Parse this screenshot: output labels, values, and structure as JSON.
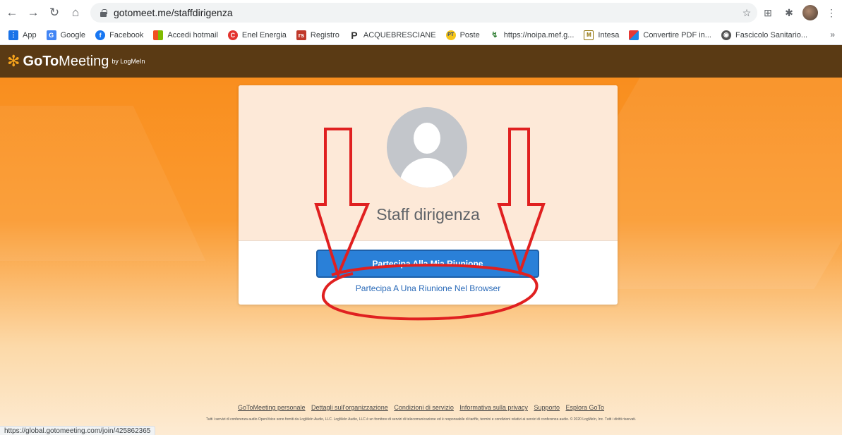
{
  "browser": {
    "url": "gotomeet.me/staffdirigenza",
    "status_url": "https://global.gotomeeting.com/join/425862365"
  },
  "bookmarks": [
    {
      "label": "App",
      "icon": "apps-grid-icon",
      "color": "#1a73e8"
    },
    {
      "label": "Google",
      "icon": "google-icon",
      "color": "#4285f4"
    },
    {
      "label": "Facebook",
      "icon": "facebook-icon",
      "color": "#1877f2"
    },
    {
      "label": "Accedi hotmail",
      "icon": "microsoft-icon",
      "color": "#f25022"
    },
    {
      "label": "Enel Energia",
      "icon": "enel-icon",
      "color": "#e3342f"
    },
    {
      "label": "Registro",
      "icon": "registro-icon",
      "color": "#c0392b"
    },
    {
      "label": "ACQUEBRESCIANE",
      "icon": "letter-p-icon",
      "color": "#333333"
    },
    {
      "label": "Poste",
      "icon": "poste-icon",
      "color": "#f5c518"
    },
    {
      "label": "https://noipa.mef.g...",
      "icon": "noipa-icon",
      "color": "#2e7d32"
    },
    {
      "label": "Intesa",
      "icon": "intesa-icon",
      "color": "#8d6e00"
    },
    {
      "label": "Convertire PDF in...",
      "icon": "pdf-convert-icon",
      "color": "#e53935"
    },
    {
      "label": "Fascicolo Sanitario...",
      "icon": "globe-icon",
      "color": "#555555"
    }
  ],
  "brand": {
    "goto": "GoTo",
    "meeting": "Meeting",
    "by": "by LogMeIn",
    "accent": "#f7a41c",
    "header_bg": "#5a3a14"
  },
  "card": {
    "org_name": "Staff dirigenza",
    "join_button": "Partecipa Alla Mia Riunione",
    "browser_link": "Partecipa A Una Riunione Nel Browser"
  },
  "footer": {
    "links": [
      "GoToMeeting personale",
      "Dettagli sull'organizzazione",
      "Condizioni di servizio",
      "Informativa sulla privacy",
      "Supporto",
      "Esplora GoTo"
    ],
    "legal": "Tutti i servizi di conferenza audio OpenVoice sono forniti da LogMeIn Audio, LLC. LogMeIn Audio, LLC è un fornitore di servizi di telecomunicazione ed è responsabile di tariffe, termini e condizioni relativi ai servizi di conferenza audio. © 2020 LogMeIn, Inc. Tutti i diritti riservati."
  }
}
